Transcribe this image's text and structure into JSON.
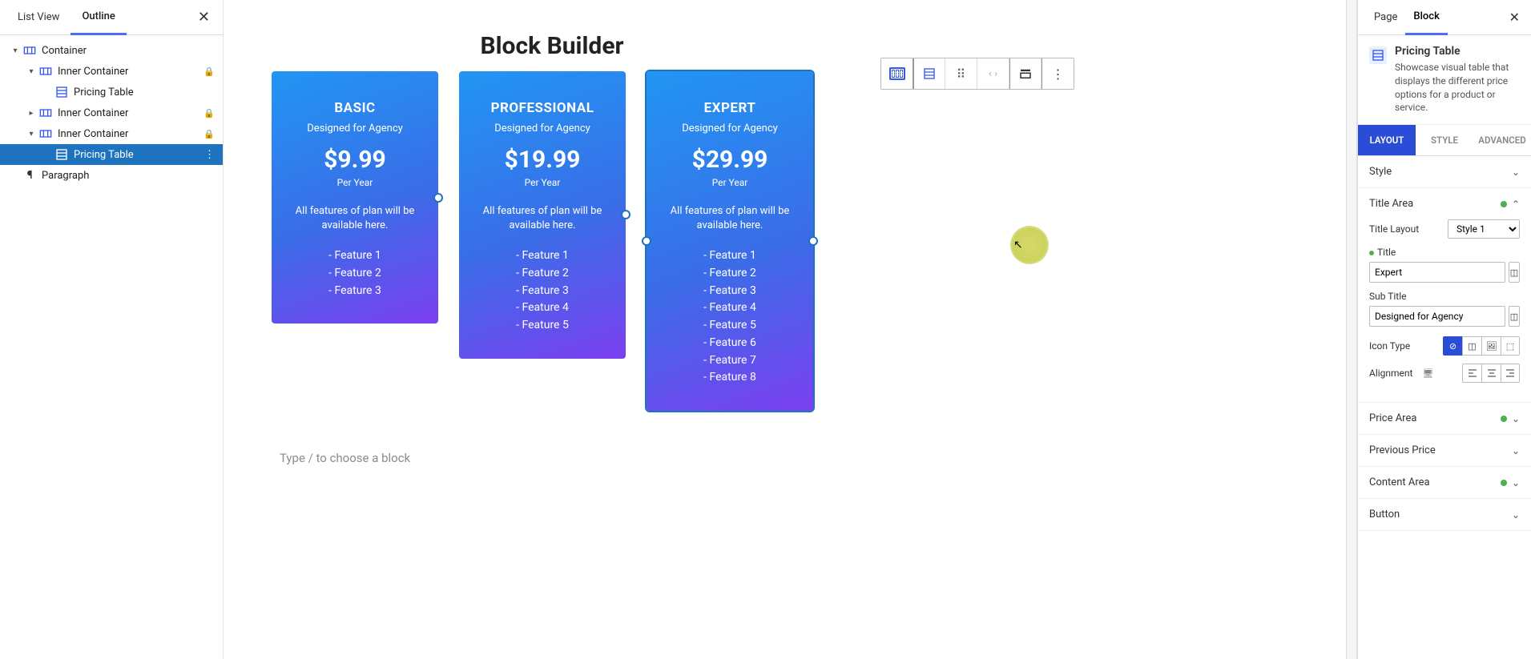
{
  "leftPanel": {
    "tabs": {
      "listView": "List View",
      "outline": "Outline"
    },
    "tree": {
      "container": "Container",
      "inner": "Inner Container",
      "pricingTable": "Pricing Table",
      "paragraph": "Paragraph"
    }
  },
  "canvas": {
    "title": "Block Builder",
    "placeholder": "Type / to choose a block",
    "cards": [
      {
        "title": "BASIC",
        "sub": "Designed for Agency",
        "price": "$9.99",
        "period": "Per Year",
        "desc": "All features of plan will be available here.",
        "features": [
          "- Feature 1",
          "- Feature 2",
          "- Feature 3"
        ]
      },
      {
        "title": "PROFESSIONAL",
        "sub": "Designed for Agency",
        "price": "$19.99",
        "period": "Per Year",
        "desc": "All features of plan will be available here.",
        "features": [
          "- Feature 1",
          "- Feature 2",
          "- Feature 3",
          "- Feature 4",
          "- Feature 5"
        ]
      },
      {
        "title": "EXPERT",
        "sub": "Designed for Agency",
        "price": "$29.99",
        "period": "Per Year",
        "desc": "All features of plan will be available here.",
        "features": [
          "- Feature 1",
          "- Feature 2",
          "- Feature 3",
          "- Feature 4",
          "- Feature 5",
          "- Feature 6",
          "- Feature 7",
          "- Feature 8"
        ]
      }
    ]
  },
  "rightPanel": {
    "tabs": {
      "page": "Page",
      "block": "Block"
    },
    "blockName": "Pricing Table",
    "blockDesc": "Showcase visual table that displays the different price options for a product or service.",
    "subtabs": {
      "layout": "LAYOUT",
      "style": "STYLE",
      "advanced": "ADVANCED"
    },
    "sections": {
      "style": "Style",
      "titleArea": "Title Area",
      "titleLayout": "Title Layout",
      "titleLayoutValue": "Style 1",
      "title": "Title",
      "titleValue": "Expert",
      "subTitle": "Sub Title",
      "subTitleValue": "Designed for Agency",
      "iconType": "Icon Type",
      "alignment": "Alignment",
      "priceArea": "Price Area",
      "previousPrice": "Previous Price",
      "contentArea": "Content Area",
      "button": "Button"
    }
  }
}
